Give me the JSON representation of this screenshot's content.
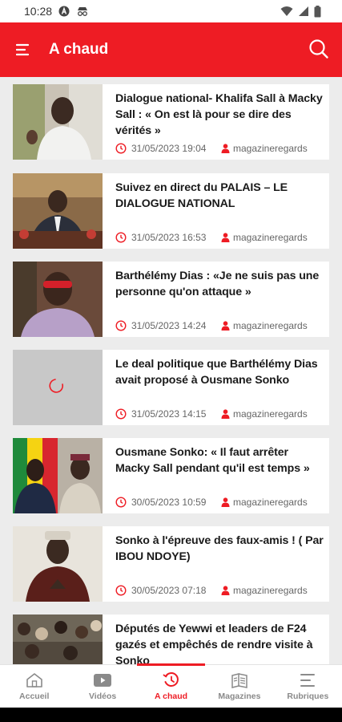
{
  "status": {
    "time": "10:28"
  },
  "header": {
    "title": "A chaud"
  },
  "articles": [
    {
      "title": "Dialogue national- Khalifa Sall à Macky Sall : « On est là pour se dire des vérités »",
      "date": "31/05/2023 19:04",
      "author": "magazineregards"
    },
    {
      "title": "Suivez en direct du PALAIS – LE DIALOGUE NATIONAL",
      "date": "31/05/2023 16:53",
      "author": "magazineregards"
    },
    {
      "title": "Barthélémy Dias : «Je ne suis pas une personne qu'on attaque »",
      "date": "31/05/2023 14:24",
      "author": "magazineregards"
    },
    {
      "title": "Le deal politique que Barthélémy Dias avait proposé à Ousmane Sonko",
      "date": "31/05/2023 14:15",
      "author": "magazineregards"
    },
    {
      "title": "Ousmane Sonko: « Il faut arrêter Macky Sall pendant qu'il est temps »",
      "date": "30/05/2023 10:59",
      "author": "magazineregards"
    },
    {
      "title": "Sonko à l'épreuve des faux-amis ! ( Par IBOU NDOYE)",
      "date": "30/05/2023 07:18",
      "author": "magazineregards"
    },
    {
      "title": "Députés de Yewwi et leaders de F24 gazés et empêchés de rendre visite à Sonko",
      "date": "",
      "author": ""
    }
  ],
  "nav": [
    {
      "label": "Accueil",
      "icon": "home-icon"
    },
    {
      "label": "Vidéos",
      "icon": "video-icon"
    },
    {
      "label": "A chaud",
      "icon": "hot-icon"
    },
    {
      "label": "Magazines",
      "icon": "magazine-icon"
    },
    {
      "label": "Rubriques",
      "icon": "menu-icon"
    }
  ],
  "colors": {
    "accent": "#ee1c24"
  }
}
